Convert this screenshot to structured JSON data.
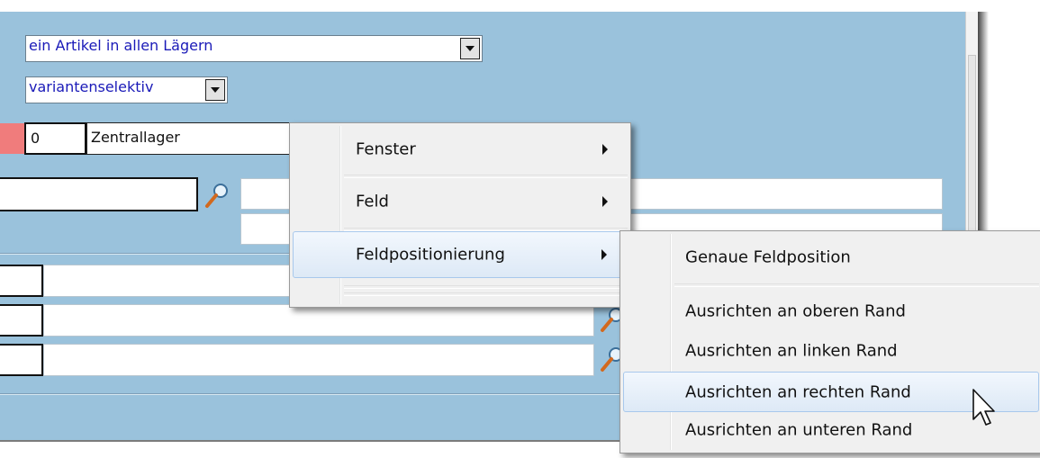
{
  "scope_select": {
    "value": "ein Artikel in allen Lägern"
  },
  "variant_select": {
    "value": "variantenselektiv"
  },
  "warehouse": {
    "number": "0",
    "name": "Zentrallager"
  },
  "context_menu": {
    "items": [
      {
        "label": "Fenster"
      },
      {
        "label": "Feld"
      },
      {
        "label": "Feldpositionierung"
      }
    ]
  },
  "submenu": {
    "items": [
      {
        "label": "Genaue Feldposition"
      },
      {
        "label": "Ausrichten an oberen Rand"
      },
      {
        "label": "Ausrichten an linken Rand"
      },
      {
        "label": "Ausrichten an rechten Rand"
      },
      {
        "label": "Ausrichten an unteren Rand"
      }
    ]
  },
  "colors": {
    "background": "#9ac2dc",
    "highlight": "#dde9f6",
    "required_marker": "#f07c7c",
    "combo_text": "#1a1ab8"
  }
}
